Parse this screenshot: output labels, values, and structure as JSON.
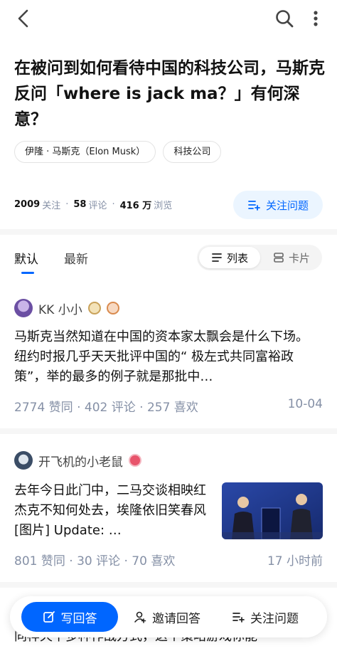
{
  "question": {
    "title": "在被问到如何看待中国的科技公司，马斯克反问「where is jack ma？」有何深意？",
    "tags": [
      "伊隆 · 马斯克（Elon Musk）",
      "科技公司"
    ],
    "stats": {
      "followers": "2009",
      "followers_label": "关注",
      "comments": "58",
      "comments_label": "评论",
      "views": "416 万",
      "views_label": "浏览"
    },
    "follow_label": "关注问题"
  },
  "sort": {
    "tabs": [
      "默认",
      "最新"
    ],
    "view_modes": [
      "列表",
      "卡片"
    ]
  },
  "answers": [
    {
      "author": "KK 小小",
      "excerpt": "马斯克当然知道在中国的资本家太飘会是什么下场。 纽约时报几乎天天批评中国的“ 极左式共同富裕政策”，举的最多的例子就是那批中…",
      "meta": "2774 赞同 · 402 评论 · 257 喜欢",
      "date": "10-04"
    },
    {
      "author": "开飞机的小老鼠",
      "excerpt": "去年今日此门中，二马交谈相映红 杰克不知何处去，埃隆依旧笑春风 [图片] Update: …",
      "meta": "801 赞同 · 30 评论 · 70 喜欢",
      "date": "17 小时前"
    }
  ],
  "peek_text": "同样天下多种作战方式，这个策略游戏你能",
  "bottom": {
    "write": "写回答",
    "invite": "邀请回答",
    "follow": "关注问题"
  },
  "colors": {
    "accent": "#0066ff",
    "muted": "#8590a6"
  }
}
